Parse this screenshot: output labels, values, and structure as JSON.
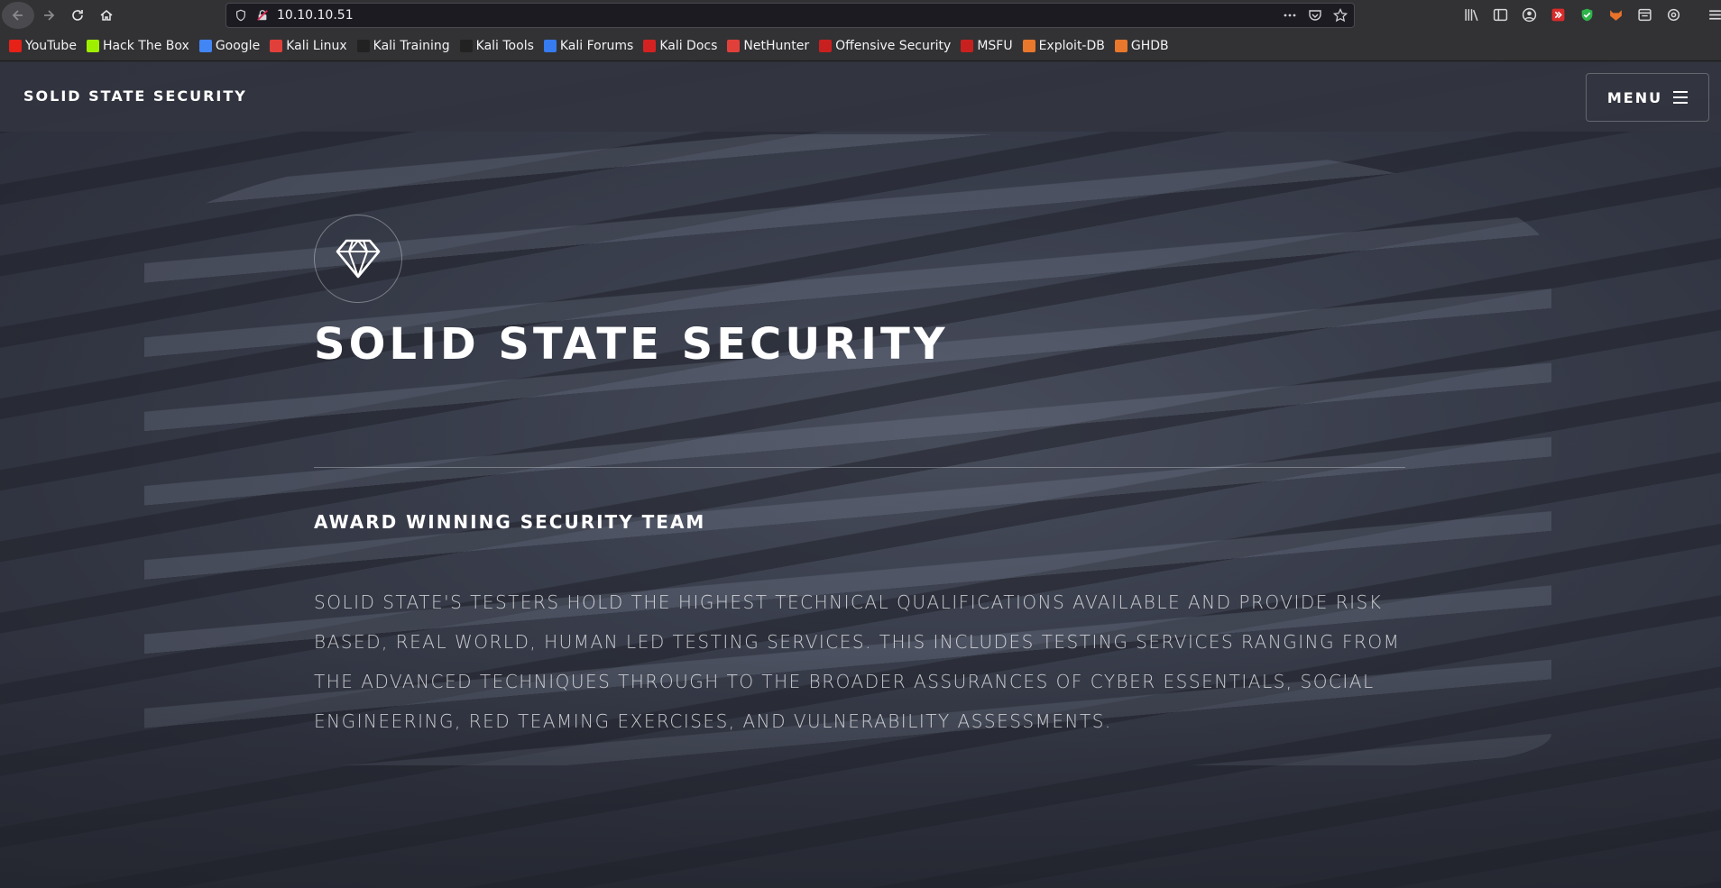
{
  "browser": {
    "url": "10.10.10.51",
    "bookmarks": [
      {
        "label": "YouTube",
        "color": "#e62117"
      },
      {
        "label": "Hack The Box",
        "color": "#9fef00"
      },
      {
        "label": "Google",
        "color": "#4285f4"
      },
      {
        "label": "Kali Linux",
        "color": "#e1403a"
      },
      {
        "label": "Kali Training",
        "color": "#222222"
      },
      {
        "label": "Kali Tools",
        "color": "#222222"
      },
      {
        "label": "Kali Forums",
        "color": "#367bf0"
      },
      {
        "label": "Kali Docs",
        "color": "#d42222"
      },
      {
        "label": "NetHunter",
        "color": "#e1403a"
      },
      {
        "label": "Offensive Security",
        "color": "#c8201f"
      },
      {
        "label": "MSFU",
        "color": "#c8201f"
      },
      {
        "label": "Exploit-DB",
        "color": "#e9772c"
      },
      {
        "label": "GHDB",
        "color": "#e9772c"
      }
    ]
  },
  "site": {
    "logo": "SOLID STATE SECURITY",
    "menu_label": "MENU"
  },
  "hero": {
    "title": "SOLID STATE SECURITY",
    "subtitle": "AWARD WINNING SECURITY TEAM",
    "body": "SOLID STATE'S TESTERS HOLD THE HIGHEST TECHNICAL QUALIFICATIONS AVAILABLE AND PROVIDE RISK BASED, REAL WORLD, HUMAN LED TESTING SERVICES. THIS INCLUDES TESTING SERVICES RANGING FROM THE ADVANCED TECHNIQUES THROUGH TO THE BROADER ASSURANCES OF CYBER ESSENTIALS, SOCIAL ENGINEERING, RED TEAMING EXERCISES, AND VULNERABILITY ASSESSMENTS."
  }
}
